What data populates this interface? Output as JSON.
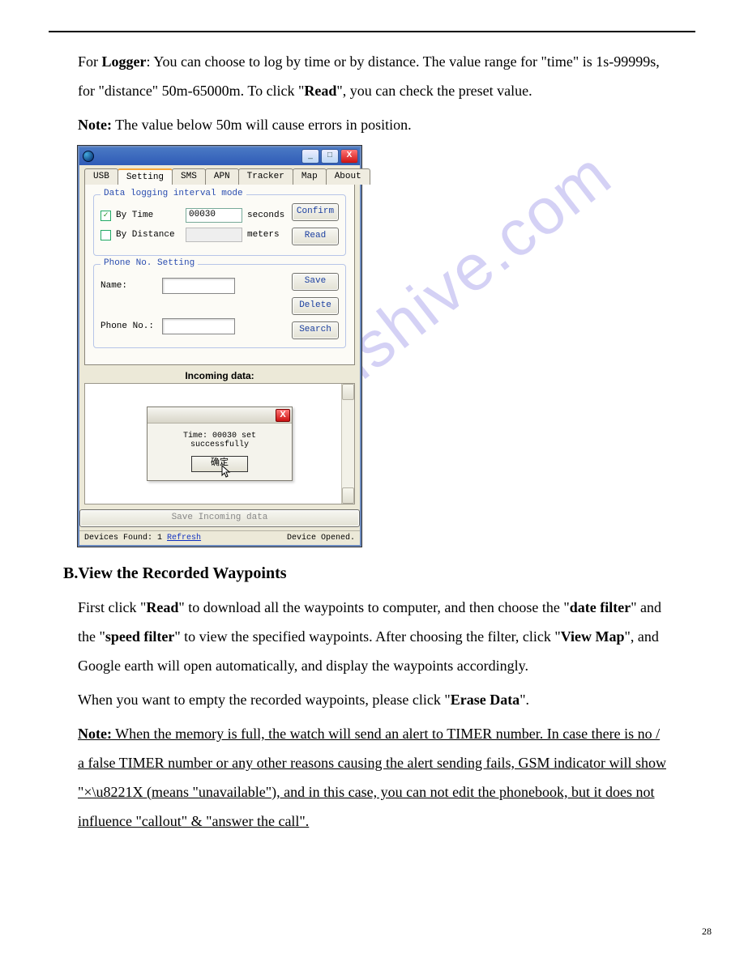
{
  "para1_a": "For ",
  "para1_b": "Logger",
  "para1_c": ": You can choose to log by time or by distance. The value range for \"time\" is 1s-99999s, for \"distance\" 50m-65000m. To click \"",
  "para1_d": "Read",
  "para1_e": "\", you can check the preset value.",
  "note1_a": "Note:",
  "note1_b": " The value below 50m will cause errors in position.",
  "app": {
    "tabs": {
      "usb": "USB",
      "setting": "Setting",
      "sms": "SMS",
      "apn": "APN",
      "tracker": "Tracker",
      "map": "Map",
      "about": "About"
    },
    "group_log_title": "Data logging interval mode",
    "by_time_label": "By Time",
    "by_time_value": "00030",
    "seconds": "seconds",
    "by_dist_label": "By Distance",
    "meters": "meters",
    "confirm": "Confirm",
    "read": "Read",
    "group_phone_title": "Phone No. Setting",
    "name_label": "Name:",
    "phone_label": "Phone No.:",
    "save": "Save",
    "delete": "Delete",
    "search": "Search",
    "incoming": "Incoming data:",
    "msg_text": "Time: 00030 set successfully",
    "ok_text": "确定",
    "save_incoming": "Save Incoming data",
    "status_left_a": "Devices Found: 1 ",
    "status_refresh": "Refresh",
    "status_right": "Device Opened."
  },
  "heading_b": "B.View the Recorded Waypoints",
  "p2a": "First click \"",
  "p2b": "Read",
  "p2c": "\" to download all the waypoints to computer, and then choose the \"",
  "p2d": "date filter",
  "p2e": "\" and the \"",
  "p2f": "speed filter",
  "p2g": "\" to view the specified waypoints. After choosing the filter, click \"",
  "p2h": "View Map",
  "p2i": "\", and Google earth will open automatically, and display the waypoints accordingly.",
  "p3a": "When you want to empty the recorded waypoints, please click \"",
  "p3b": "Erase Data",
  "p3c": "\".",
  "p4a": "Note:",
  "p4b": " When the memory is full, the watch will send an alert to TIMER number. In case there is no / a false TIMER number or any other reasons causing the alert sending fails, GSM indicator will show \"×\\u8221X (means \"unavailable\"), and in this case, you can not edit the phonebook, but it does not influence \"callout\" & \"answer the call\".",
  "page_number": "28",
  "watermark": "manualshive.com"
}
